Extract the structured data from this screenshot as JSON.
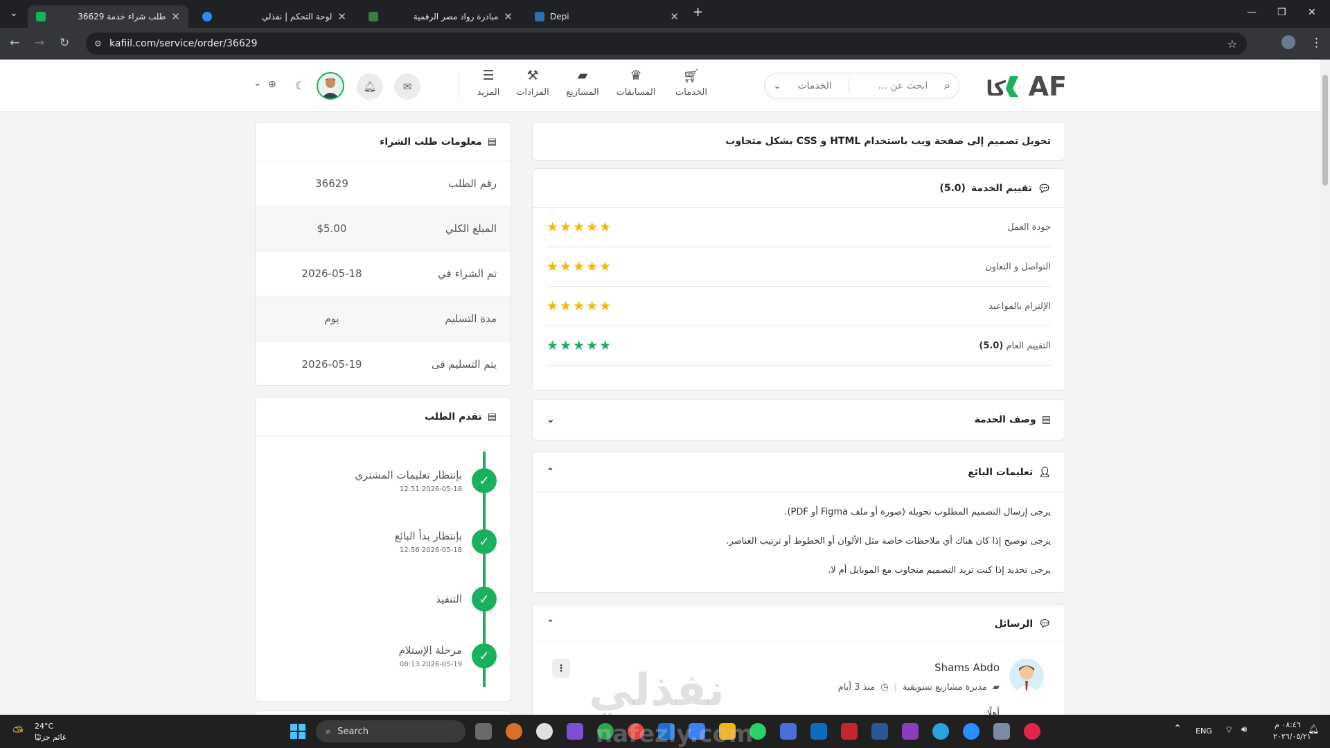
{
  "browser": {
    "tabs": [
      {
        "title": "طلب شراء خدمة 36629",
        "active": true
      },
      {
        "title": "لوحة التحكم | نفذلي",
        "active": false
      },
      {
        "title": "مبادرة رواد مصر الرقمية",
        "active": false
      },
      {
        "title": "Depi",
        "active": false
      }
    ],
    "url": "kafiil.com/service/order/36629"
  },
  "header": {
    "logo_text": "كافAF",
    "search_placeholder": "ابحث عن ...",
    "search_scope": "الخدمات",
    "nav": [
      {
        "label": "الخدمات",
        "icon": "cart-icon"
      },
      {
        "label": "المسابقات",
        "icon": "trophy-icon"
      },
      {
        "label": "المشاريع",
        "icon": "briefcase-icon"
      },
      {
        "label": "المزادات",
        "icon": "gavel-icon"
      },
      {
        "label": "المزيد",
        "icon": "menu-icon"
      }
    ]
  },
  "service": {
    "title": "تحويل تصميم إلى صفحة ويب باستخدام HTML و CSS بشكل متجاوب"
  },
  "rating": {
    "title": "تقييم الخدمة",
    "score": "(5.0)",
    "rows": [
      {
        "label": "جودة العمل",
        "stars": 5
      },
      {
        "label": "التواصل و التعاون",
        "stars": 5
      },
      {
        "label": "الإلتزام بالمواعيد",
        "stars": 5
      },
      {
        "label": "التقييم العام",
        "score": "(5.0)",
        "stars": 5
      }
    ]
  },
  "description": {
    "title": "وصف الخدمة"
  },
  "seller_instructions": {
    "title": "تعليمات البائع",
    "lines": [
      "يرجى إرسال التصميم المطلوب تحويله (صورة أو ملف Figma أو PDF).",
      "يرجى توضيح إذا كان هناك أي ملاحظات خاصة مثل الألوان أو الخطوط أو ترتيب العناصر.",
      "يرجى تحديد إذا كنت تريد التصميم متجاوب مع الموبايل أم لا."
    ]
  },
  "messages": {
    "title": "الرسائل",
    "sender_name": "Shams Abdo",
    "sender_role": "مديرة مشاريع تسويقية",
    "sender_time": "منذ 3 أيام",
    "partial_text": "أهلًا"
  },
  "order_info": {
    "title": "معلومات طلب الشراء",
    "rows": [
      {
        "label": "رقم الطلب",
        "value": "36629"
      },
      {
        "label": "المبلغ الكلي",
        "value": "$5.00"
      },
      {
        "label": "تم الشراء في",
        "value": "2026-05-18"
      },
      {
        "label": "مدة التسليم",
        "value": "يوم"
      },
      {
        "label": "يتم التسليم فى",
        "value": "2026-05-19"
      }
    ]
  },
  "progress": {
    "title": "تقدم الطلب",
    "steps": [
      {
        "label": "بإنتظار تعليمات المشتري",
        "date": "12:51 2026-05-18"
      },
      {
        "label": "بإنتظار بدأ البائع",
        "date": "12:56 2026-05-18"
      },
      {
        "label": "التنفيذ",
        "date": ""
      },
      {
        "label": "مرحلة الإستلام",
        "date": "08:13 2026-05-19"
      }
    ]
  },
  "watermark": {
    "arabic": "نفذلي",
    "latin": "nafezly.com"
  },
  "taskbar": {
    "weather_temp": "24°C",
    "weather_desc": "غائم جزئيًا",
    "search_label": "Search",
    "lang": "ENG",
    "time": "٠٨:٤٦ م",
    "date": "٢٠٢٦/٠٥/٢١"
  },
  "colors": {
    "accent": "#1ab05c",
    "star": "#f5b800"
  }
}
